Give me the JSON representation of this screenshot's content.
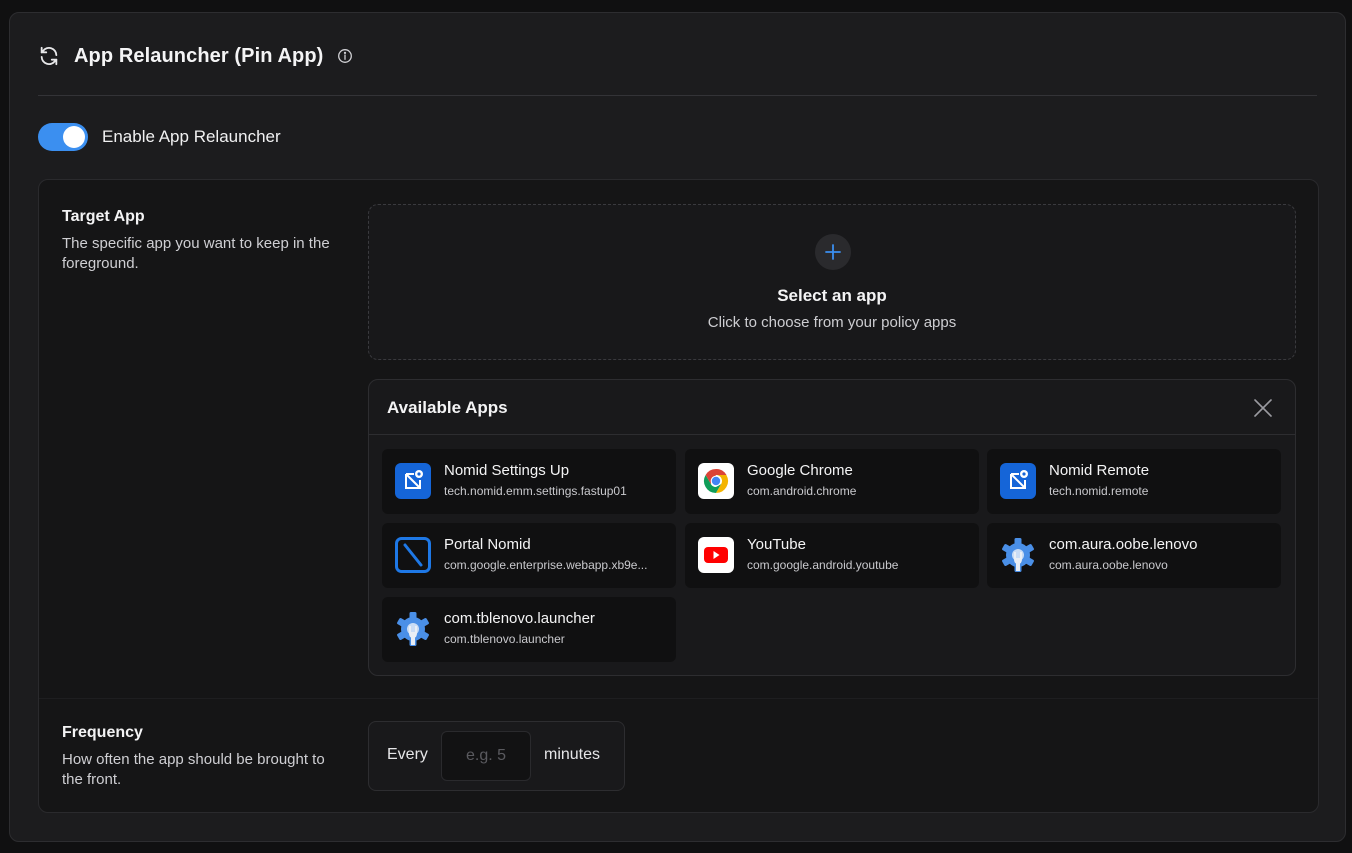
{
  "header": {
    "title": "App Relauncher (Pin App)",
    "title_icon": "refresh-icon",
    "info_icon": "info-icon"
  },
  "toggle": {
    "label": "Enable App Relauncher",
    "enabled": true,
    "accent_color": "#3b8ff0"
  },
  "target_app": {
    "title": "Target App",
    "description": "The specific app you want to keep in the foreground."
  },
  "select_app": {
    "icon": "plus-icon",
    "title": "Select an app",
    "subtitle": "Click to choose from your policy apps"
  },
  "available_apps": {
    "title": "Available Apps",
    "close_icon": "close-icon",
    "apps": [
      {
        "name": "Nomid Settings Up",
        "package": "tech.nomid.emm.settings.fastup01",
        "icon": "nomid-settings-icon"
      },
      {
        "name": "Google Chrome",
        "package": "com.android.chrome",
        "icon": "chrome-icon"
      },
      {
        "name": "Nomid Remote",
        "package": "tech.nomid.remote",
        "icon": "nomid-remote-icon"
      },
      {
        "name": "Portal Nomid",
        "package": "com.google.enterprise.webapp.xb9e...",
        "icon": "portal-nomid-icon"
      },
      {
        "name": "YouTube",
        "package": "com.google.android.youtube",
        "icon": "youtube-icon"
      },
      {
        "name": "com.aura.oobe.lenovo",
        "package": "com.aura.oobe.lenovo",
        "icon": "android-settings-gear-icon"
      },
      {
        "name": "com.tblenovo.launcher",
        "package": "com.tblenovo.launcher",
        "icon": "android-settings-gear-icon"
      }
    ]
  },
  "frequency": {
    "title": "Frequency",
    "description": "How often the app should be brought to the front.",
    "prefix": "Every",
    "placeholder": "e.g. 5",
    "value": "",
    "suffix": "minutes"
  }
}
